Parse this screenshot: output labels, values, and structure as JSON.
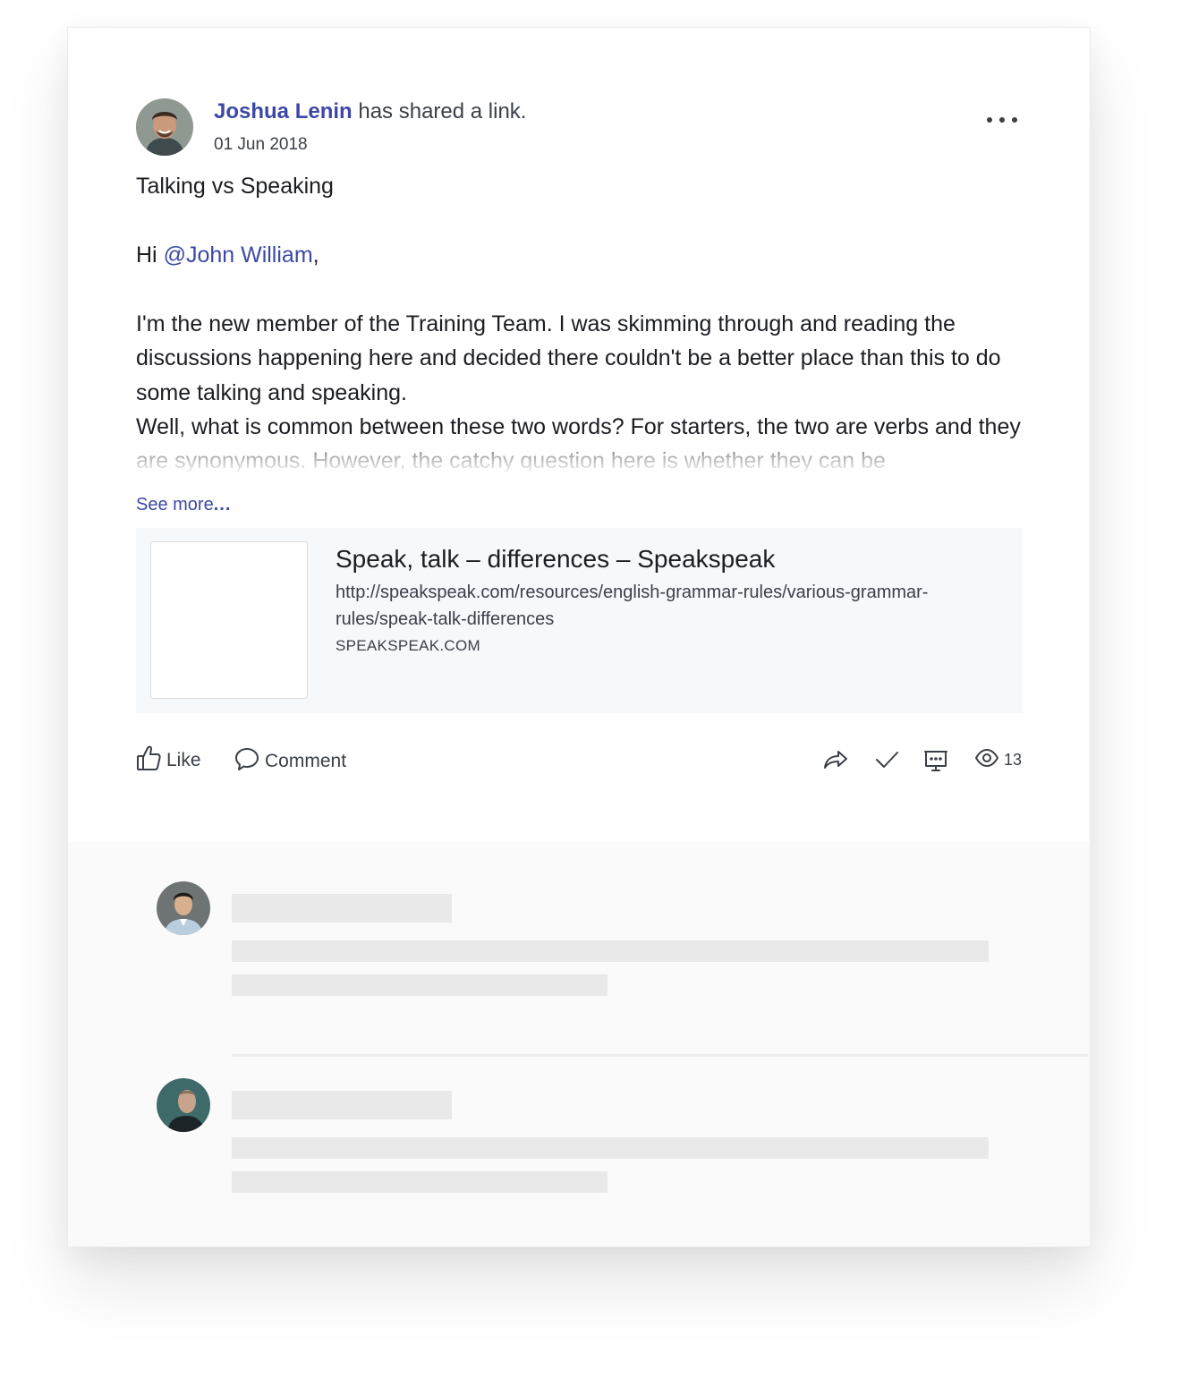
{
  "post": {
    "author": "Joshua Lenin",
    "action_text": " has shared a link.",
    "date": "01 Jun 2018",
    "title": "Talking vs Speaking",
    "greeting_prefix": "Hi ",
    "mention": "@John William",
    "greeting_suffix": ",",
    "body_paragraphs": [
      "I'm the new member of the Training Team. I was skimming through and reading the discussions happening here and decided there couldn't be a better place than this to do some talking and speaking.",
      "Well, what is common between these two words? For starters, the two are verbs and they are synonymous. However, the catchy question here is whether they can be"
    ],
    "see_more_label": "See more",
    "see_more_dots": "...",
    "more_menu_icon": "more-horizontal-icon"
  },
  "link_preview": {
    "title": "Speak, talk – differences – Speakspeak",
    "url": "http://speakspeak.com/resources/english-grammar-rules/various-grammar-rules/speak-talk-differences",
    "domain": "SPEAKSPEAK.COM"
  },
  "actions": {
    "like_label": "Like",
    "comment_label": "Comment",
    "view_count": "13",
    "icons": [
      "thumbs-up-icon",
      "comment-bubble-icon",
      "share-icon",
      "check-icon",
      "presentation-icon",
      "eye-icon"
    ]
  },
  "colors": {
    "accent": "#3d48a6",
    "text": "#1b1d22",
    "muted": "#3b3f48",
    "preview_bg": "#f5f9fc",
    "skeleton": "#e9e9e9",
    "comments_bg": "#fafafa"
  }
}
